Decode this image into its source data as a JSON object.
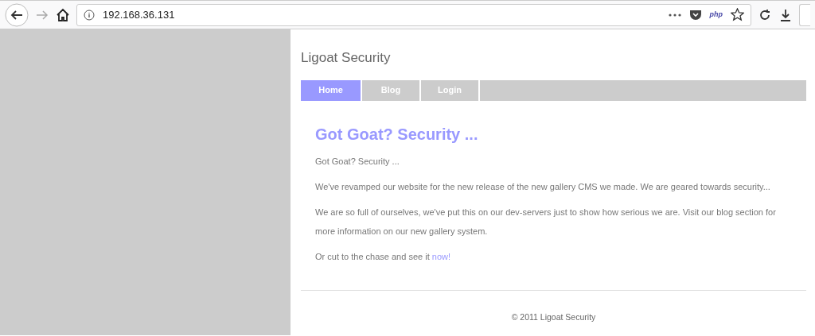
{
  "browser": {
    "url": "192.168.36.131",
    "extension_label": "php"
  },
  "site": {
    "title": "Ligoat Security",
    "nav": [
      {
        "label": "Home",
        "selected": true
      },
      {
        "label": "Blog",
        "selected": false
      },
      {
        "label": "Login",
        "selected": false
      }
    ],
    "heading": "Got Goat? Security ...",
    "paragraphs": [
      {
        "text": "Got Goat? Security ..."
      },
      {
        "text": "We've revamped our website for the new release of the new gallery CMS we made. We are geared towards security..."
      },
      {
        "text": "We are so full of ourselves, we've put this on our dev-servers just to show how serious we are. Visit our blog section for more information on our new gallery system."
      },
      {
        "text": "Or cut to the chase and see it",
        "link": "now!"
      }
    ],
    "footer": "© 2011 Ligoat Security"
  }
}
